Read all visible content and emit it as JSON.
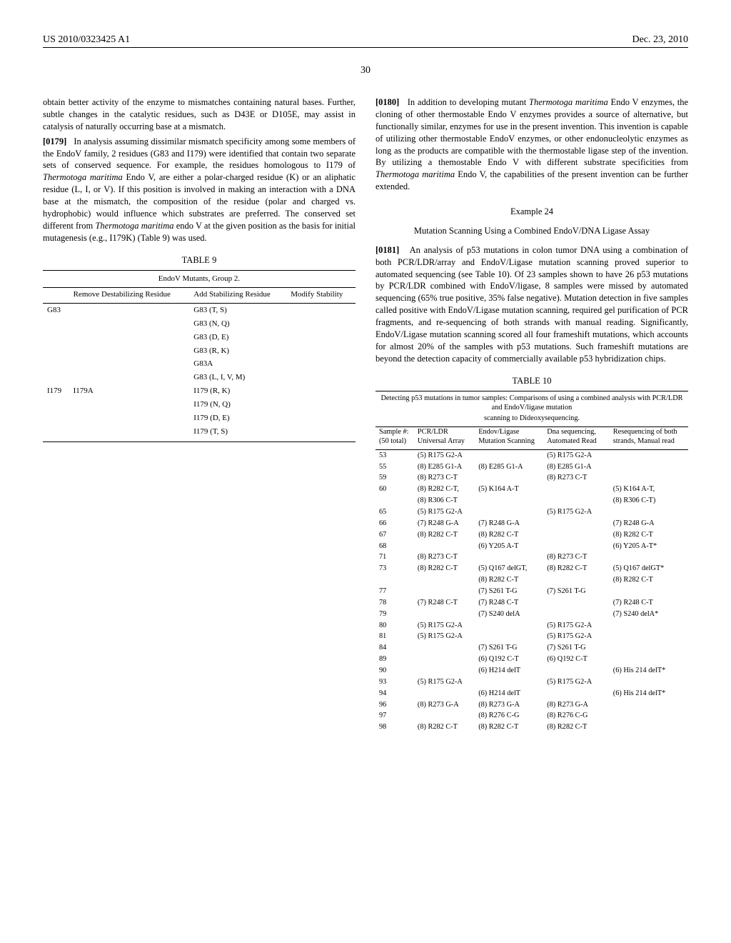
{
  "header": {
    "pub_number": "US 2010/0323425 A1",
    "pub_date": "Dec. 23, 2010",
    "page_number": "30"
  },
  "left": {
    "p1": "obtain better activity of the enzyme to mismatches containing natural bases. Further, subtle changes in the catalytic residues, such as D43E or D105E, may assist in catalysis of naturally occurring base at a mismatch.",
    "p2_num": "[0179]",
    "p2": "In analysis assuming dissimilar mismatch specificity among some members of the EndoV family, 2 residues (G83 and I179) were identified that contain two separate sets of conserved sequence. For example, the residues homologous to I179 of ",
    "p2_it": "Thermotoga maritima",
    "p2b": " Endo V, are either a polar-charged residue (K) or an aliphatic residue (L, I, or V). If this position is involved in making an interaction with a DNA base at the mismatch, the composition of the residue (polar and charged vs. hydrophobic) would influence which substrates are preferred. The conserved set different from ",
    "p2_it2": "Thermotoga maritima",
    "p2c": " endo V at the given position as the basis for initial mutagenesis (e.g., I179K) (Table 9) was used.",
    "table9": {
      "title": "TABLE 9",
      "caption": "EndoV Mutants, Group 2.",
      "head": {
        "a": "",
        "b": "Remove Destabilizing Residue",
        "c": "Add Stabilizing Residue",
        "d": "Modify Stability"
      },
      "rows": [
        {
          "a": "G83",
          "b": "",
          "c": [
            "G83 (T, S)",
            "G83 (N, Q)",
            "G83 (D, E)",
            "G83 (R, K)",
            "G83A",
            "G83 (L, I, V, M)"
          ],
          "d": ""
        },
        {
          "a": "I179",
          "b": "I179A",
          "c": [
            "I179 (R, K)",
            "I179 (N, Q)",
            "I179 (D, E)",
            "I179 (T, S)"
          ],
          "d": ""
        }
      ]
    }
  },
  "right": {
    "p1_num": "[0180]",
    "p1a": "In addition to developing mutant ",
    "p1_it": "Thermotoga maritima",
    "p1b": " Endo V enzymes, the cloning of other thermostable Endo V enzymes provides a source of alternative, but functionally similar, enzymes for use in the present invention. This invention is capable of utilizing other thermostable EndoV enzymes, or other endonucleolytic enzymes as long as the products are compatible with the thermostable ligase step of the invention. By utilizing a themostable Endo V with different substrate specificities from ",
    "p1_it2": "Thermotoga maritima",
    "p1c": " Endo V, the capabilities of the present invention can be further extended.",
    "example_label": "Example 24",
    "example_title": "Mutation Scanning Using a Combined EndoV/DNA Ligase Assay",
    "p2_num": "[0181]",
    "p2": "An analysis of p53 mutations in colon tumor DNA using a combination of both PCR/LDR/array and EndoV/Ligase mutation scanning proved superior to automated sequencing (see Table 10). Of 23 samples shown to have 26 p53 mutations by PCR/LDR combined with EndoV/ligase, 8 samples were missed by automated sequencing (65% true positive, 35% false negative). Mutation detection in five samples called positive with EndoV/Ligase mutation scanning, required gel purification of PCR fragments, and re-sequencing of both strands with manual reading. Significantly, EndoV/Ligase mutation scanning scored all four frameshift mutations, which accounts for almost 20% of the samples with p53 mutations. Such frameshift mutations are beyond the detection capacity of commercially available p53 hybridization chips.",
    "table10": {
      "title": "TABLE 10",
      "caption1": "Detecting p53 mutations in tumor samples: Comparisons of using a combined analysis with PCR/LDR and EndoV/ligase mutation",
      "caption2": "scanning to Dideoxysequencing.",
      "head": {
        "a": "Sample #: (50 total)",
        "b": "PCR/LDR Universal Array",
        "c": "Endov/Ligase Mutation Scanning",
        "d": "Dna sequencing, Automated Read",
        "e": "Resequencing of both strands, Manual read"
      },
      "rows": [
        {
          "a": "53",
          "b": "(5) R175 G2-A",
          "c": "",
          "d": "(5) R175 G2-A",
          "e": ""
        },
        {
          "a": "55",
          "b": "(8) E285 G1-A",
          "c": "(8) E285 G1-A",
          "d": "(8) E285 G1-A",
          "e": ""
        },
        {
          "a": "59",
          "b": "(8) R273 C-T",
          "c": "",
          "d": "(8) R273 C-T",
          "e": ""
        },
        {
          "a": "60",
          "b": "(8) R282 C-T,",
          "c": "(5) K164 A-T",
          "d": "",
          "e": "(5) K164 A-T,"
        },
        {
          "a": "",
          "b": "(8) R306 C-T",
          "c": "",
          "d": "",
          "e": "(8) R306 C-T)"
        },
        {
          "a": "65",
          "b": "(5) R175 G2-A",
          "c": "",
          "d": "(5) R175 G2-A",
          "e": ""
        },
        {
          "a": "66",
          "b": "(7) R248 G-A",
          "c": "(7) R248 G-A",
          "d": "",
          "e": "(7) R248 G-A"
        },
        {
          "a": "67",
          "b": "(8) R282 C-T",
          "c": "(8) R282 C-T",
          "d": "",
          "e": "(8) R282 C-T"
        },
        {
          "a": "68",
          "b": "",
          "c": "(6) Y205 A-T",
          "d": "",
          "e": "(6) Y205 A-T*"
        },
        {
          "a": "71",
          "b": "(8) R273 C-T",
          "c": "",
          "d": "(8) R273 C-T",
          "e": ""
        },
        {
          "a": "73",
          "b": "(8) R282 C-T",
          "c": "(5) Q167 delGT,",
          "d": "(8) R282 C-T",
          "e": "(5) Q167 delGT*"
        },
        {
          "a": "",
          "b": "",
          "c": "(8) R282 C-T",
          "d": "",
          "e": "(8) R282 C-T"
        },
        {
          "a": "77",
          "b": "",
          "c": "(7) S261 T-G",
          "d": "(7) S261 T-G",
          "e": ""
        },
        {
          "a": "78",
          "b": "(7) R248 C-T",
          "c": "(7) R248 C-T",
          "d": "",
          "e": "(7) R248 C-T"
        },
        {
          "a": "79",
          "b": "",
          "c": "(7) S240 delA",
          "d": "",
          "e": "(7) S240 delA*"
        },
        {
          "a": "80",
          "b": "(5) R175 G2-A",
          "c": "",
          "d": "(5) R175 G2-A",
          "e": ""
        },
        {
          "a": "81",
          "b": "(5) R175 G2-A",
          "c": "",
          "d": "(5) R175 G2-A",
          "e": ""
        },
        {
          "a": "84",
          "b": "",
          "c": "(7) S261 T-G",
          "d": "(7) S261 T-G",
          "e": ""
        },
        {
          "a": "89",
          "b": "",
          "c": "(6) Q192 C-T",
          "d": "(6) Q192 C-T",
          "e": ""
        },
        {
          "a": "90",
          "b": "",
          "c": "(6) H214 delT",
          "d": "",
          "e": "(6) His 214 delT*"
        },
        {
          "a": "93",
          "b": "(5) R175 G2-A",
          "c": "",
          "d": "(5) R175 G2-A",
          "e": ""
        },
        {
          "a": "94",
          "b": "",
          "c": "(6) H214 delT",
          "d": "",
          "e": "(6) His 214 delT*"
        },
        {
          "a": "96",
          "b": "(8) R273 G-A",
          "c": "(8) R273 G-A",
          "d": "(8) R273 G-A",
          "e": ""
        },
        {
          "a": "97",
          "b": "",
          "c": "(8) R276 C-G",
          "d": "(8) R276 C-G",
          "e": ""
        },
        {
          "a": "98",
          "b": "(8) R282 C-T",
          "c": "(8) R282 C-T",
          "d": "(8) R282 C-T",
          "e": ""
        }
      ]
    }
  }
}
